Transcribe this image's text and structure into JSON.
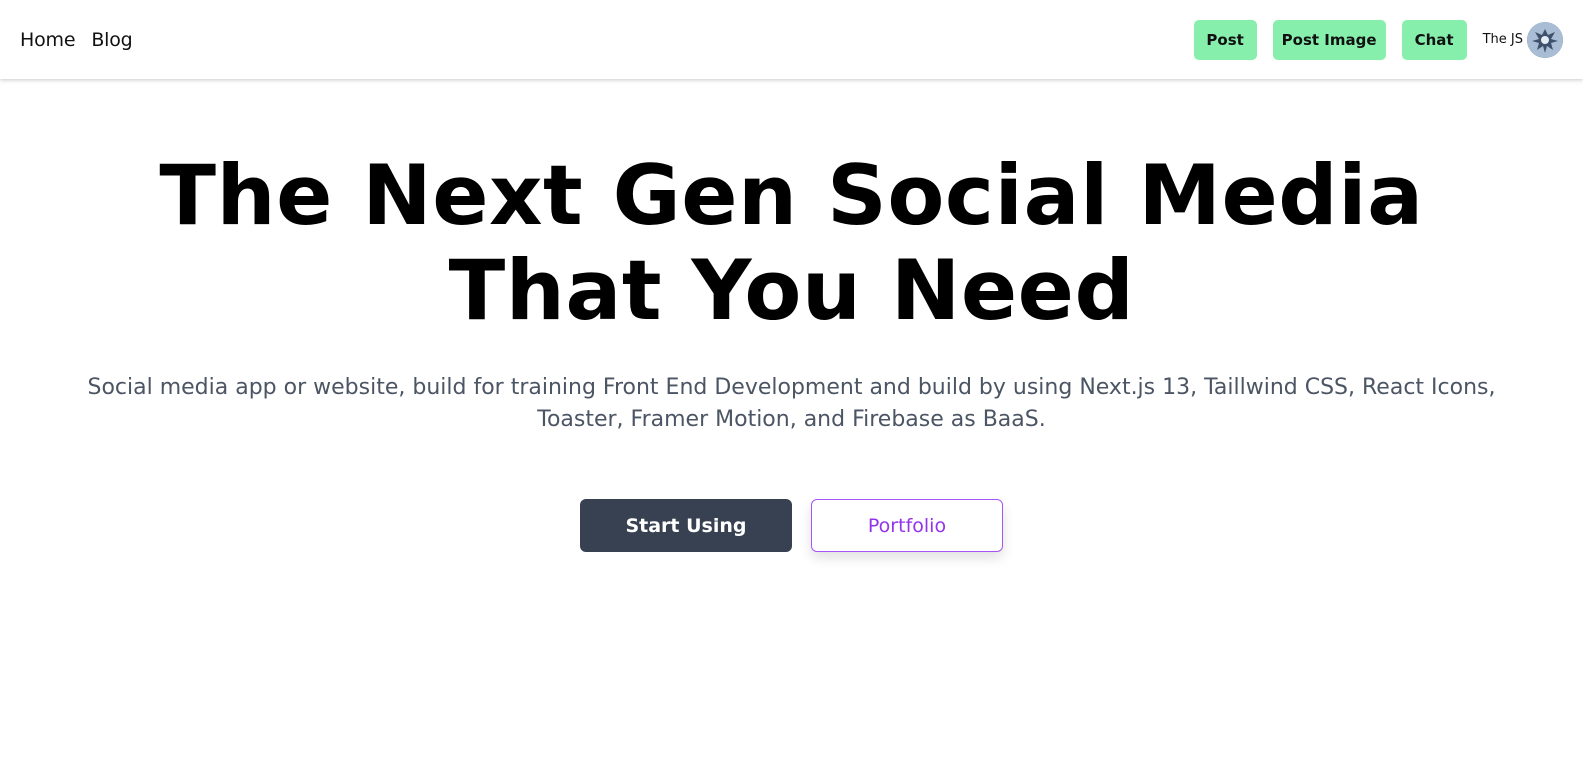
{
  "nav": {
    "links": [
      "Home",
      "Blog"
    ],
    "buttons": [
      "Post",
      "Post Image",
      "Chat"
    ],
    "user_name": "The JS",
    "button_color": "#86efac"
  },
  "hero": {
    "title_line1": "The Next Gen Social Media",
    "title_line2": "That You Need",
    "subtitle": "Social media app or website, build for training Front End Development and build by using Next.js 13, Taillwind CSS, React Icons, Toaster, Framer Motion, and Firebase as BaaS.",
    "primary_button": "Start Using",
    "secondary_button": "Portfolio",
    "primary_color": "#374151",
    "accent_color": "#a855f7"
  }
}
